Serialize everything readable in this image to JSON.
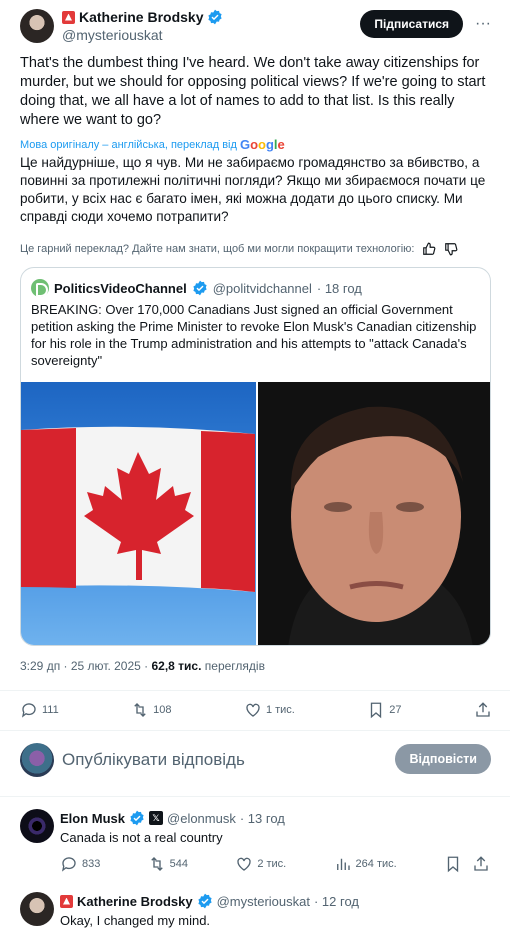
{
  "tweet": {
    "author_name": "Katherine Brodsky",
    "author_handle": "@mysteriouskat",
    "subscribe_label": "Підписатися",
    "text": "That's the dumbest thing I've heard. We don't take away citizenships for murder, but we should for opposing political views? If we're going to start doing that, we all have a lot of names to add to that list. Is this really where we want to go?",
    "translation_note": "Мова оригіналу – англійська, переклад від",
    "translation_provider": "Google",
    "translated_text": "Це найдурніше, що я чув. Ми не забираємо громадянство за вбивство, а повинні за протилежні політичні погляди? Якщо ми збираємося почати це робити, у всіх нас є багато імен, які можна додати до цього списку. Ми справді сюди хочемо потрапити?",
    "feedback_text": "Це гарний переклад? Дайте нам знати, щоб ми могли покращити технологію:",
    "time": "3:29 дп · 25 лют. 2025 ·",
    "views_count": "62,8 тис.",
    "views_label": "переглядів",
    "replies": "111",
    "reposts": "108",
    "likes": "1 тис.",
    "bookmarks": "27"
  },
  "quote": {
    "author_name": "PoliticsVideoChannel",
    "author_handle": "@politvidchannel",
    "time": "· 18 год",
    "text": "BREAKING: Over 170,000 Canadians Just signed an official Government petition asking the Prime Minister to revoke Elon Musk's Canadian citizenship for his role in the Trump administration and his attempts to \"attack Canada's sovereignty\""
  },
  "reply_box": {
    "placeholder": "Опублікувати відповідь",
    "button_label": "Відповісти"
  },
  "replies": [
    {
      "author_name": "Elon Musk",
      "author_handle": "@elonmusk",
      "time": "· 13 год",
      "text": "Canada is not a real country",
      "replies": "833",
      "reposts": "544",
      "likes": "2 тис.",
      "views": "264 тис."
    },
    {
      "author_name": "Katherine Brodsky",
      "author_handle": "@mysteriouskat",
      "time": "· 12 год",
      "text": "Okay, I changed my mind."
    }
  ],
  "colors": {
    "accent": "#1d9bf0",
    "text": "#0f1419",
    "muted": "#536471",
    "border": "#cfd9de"
  }
}
